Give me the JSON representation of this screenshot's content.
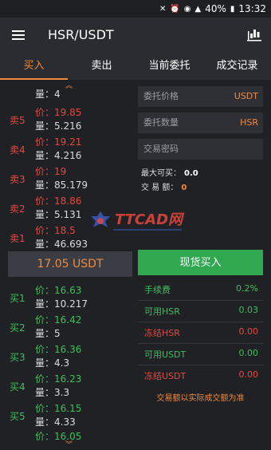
{
  "status": {
    "signal": "40%",
    "time": "13:32"
  },
  "app": {
    "title": "HSR/USDT"
  },
  "tabs": [
    {
      "label": "买入",
      "active": true
    },
    {
      "label": "卖出"
    },
    {
      "label": "当前委托"
    },
    {
      "label": "成交记录"
    }
  ],
  "book": {
    "sell": [
      {
        "side": "",
        "price": "",
        "vol": "量：4"
      },
      {
        "side": "卖5",
        "price": "价：19.85",
        "vol": "量：5.216"
      },
      {
        "side": "卖4",
        "price": "价：19.21",
        "vol": "量：4.216"
      },
      {
        "side": "卖3",
        "price": "价：19",
        "vol": "量：85.179"
      },
      {
        "side": "卖2",
        "price": "价：18.86",
        "vol": "量：5.131"
      },
      {
        "side": "卖1",
        "price": "价：18.5",
        "vol": "量：46.693"
      }
    ],
    "last_price": "17.05 USDT",
    "buy": [
      {
        "side": "买1",
        "price": "价：16.63",
        "vol": "量：10.217"
      },
      {
        "side": "买2",
        "price": "价：16.42",
        "vol": "量：5"
      },
      {
        "side": "买3",
        "price": "价：16.36",
        "vol": "量：4.3"
      },
      {
        "side": "买4",
        "price": "价：16.23",
        "vol": "量：3.3"
      },
      {
        "side": "买5",
        "price": "价：16.15",
        "vol": "量：4.33"
      },
      {
        "side": "",
        "price": "价：16.05",
        "vol": ""
      }
    ]
  },
  "form": {
    "price_placeholder": "委托价格",
    "price_unit": "USDT",
    "amount_placeholder": "委托数量",
    "amount_unit": "HSR",
    "password_placeholder": "交易密码",
    "max_buy_label": "最大可买：",
    "max_buy_value": "0.0",
    "trade_amount_label": "交 易 额：",
    "trade_amount_value": "0",
    "buy_button": "现货买入"
  },
  "balances": [
    {
      "label": "手续费",
      "value": "0.2%",
      "tone": "green"
    },
    {
      "label": "可用HSR",
      "value": "0.03",
      "tone": "green"
    },
    {
      "label": "冻结HSR",
      "value": "0.00",
      "tone": "red"
    },
    {
      "label": "可用USDT",
      "value": "0.00",
      "tone": "green"
    },
    {
      "label": "冻结USDT",
      "value": "0.00",
      "tone": "red"
    }
  ],
  "note": "交易额以实际成交额为准",
  "watermark": "TTCAD网"
}
